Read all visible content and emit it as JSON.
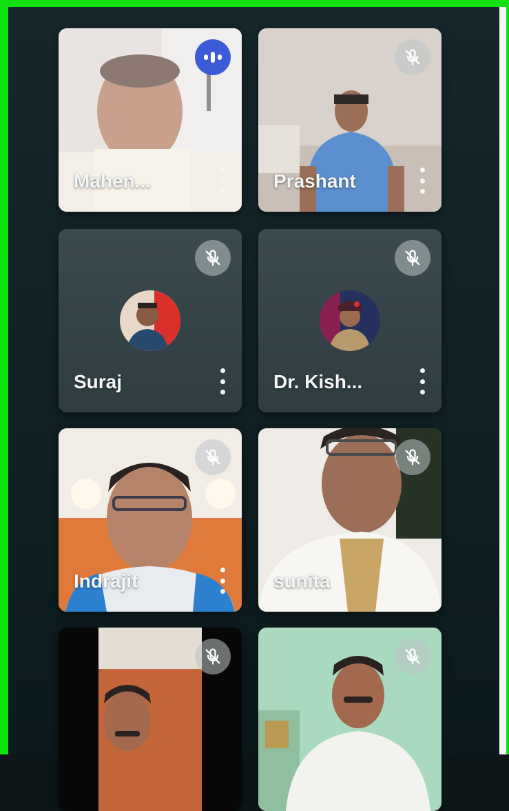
{
  "participants": [
    {
      "name": "Mahen...",
      "mic": "speaking",
      "icon": "speaking-indicator-icon"
    },
    {
      "name": "Prashant",
      "mic": "muted",
      "icon": "mic-off-icon"
    },
    {
      "name": "Suraj",
      "mic": "muted",
      "icon": "mic-off-icon"
    },
    {
      "name": "Dr. Kish...",
      "mic": "muted",
      "icon": "mic-off-icon"
    },
    {
      "name": "Indrajit",
      "mic": "muted",
      "icon": "mic-off-icon"
    },
    {
      "name": "sunita",
      "mic": "muted",
      "icon": "mic-off-icon"
    },
    {
      "name": "",
      "mic": "muted",
      "icon": "mic-off-icon"
    },
    {
      "name": "",
      "mic": "muted",
      "icon": "mic-off-icon"
    }
  ],
  "colors": {
    "accent_speaking": "#3c5bd6",
    "border_highlight": "#11e011",
    "background": "#0f1f22"
  }
}
